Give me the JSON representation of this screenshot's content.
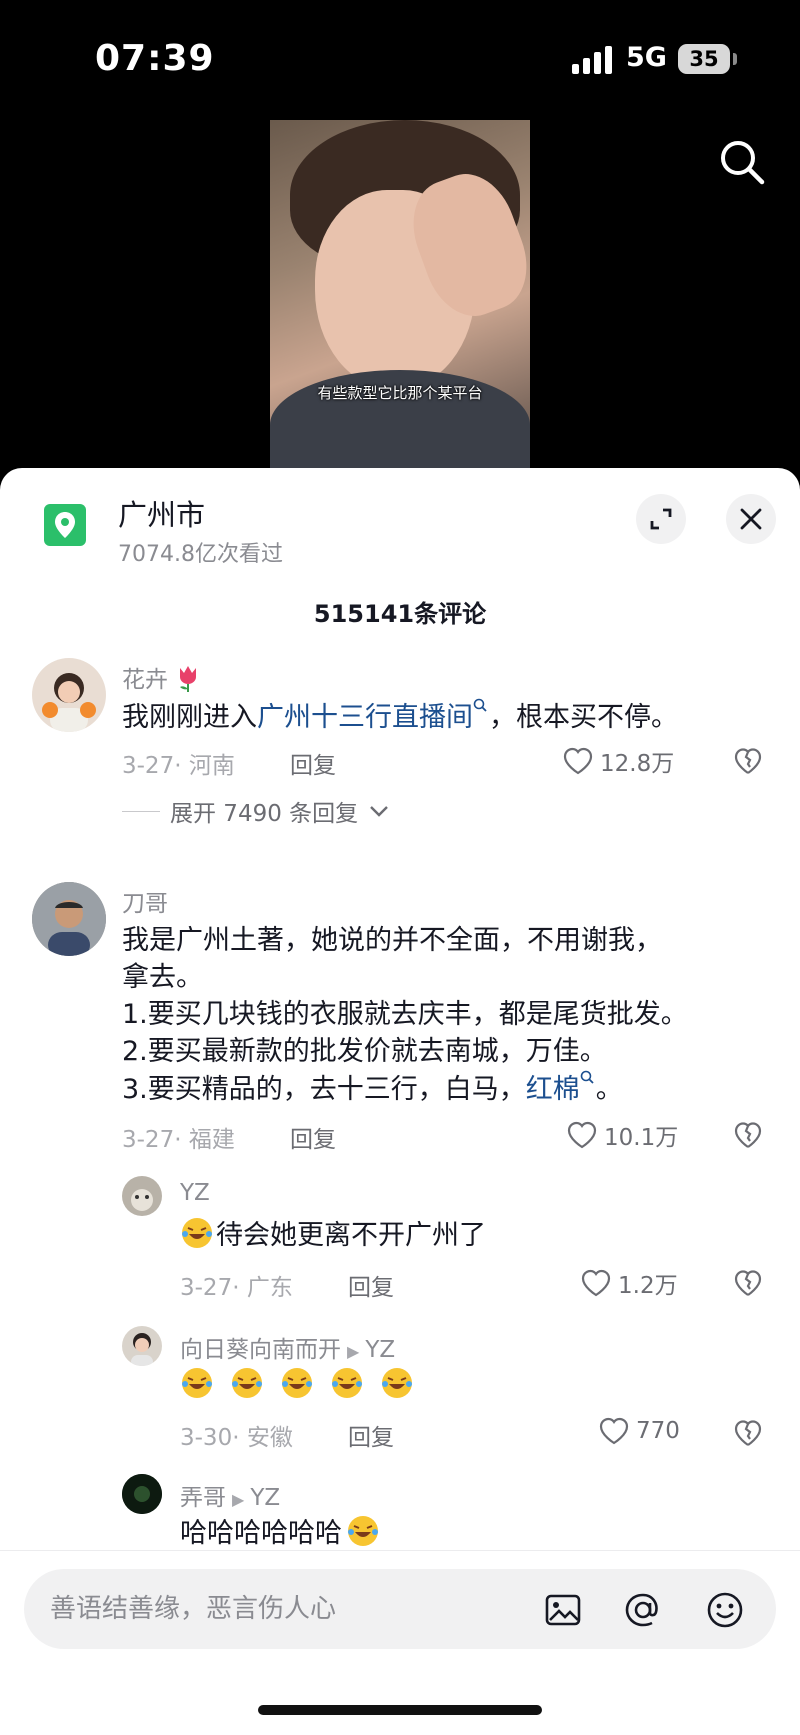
{
  "status_bar": {
    "time": "07:39",
    "network": "5G",
    "battery": "35"
  },
  "video": {
    "caption": "有些款型它比那个某平台"
  },
  "location": {
    "title": "广州市",
    "views": "7074.8亿次看过"
  },
  "comments_header": {
    "title": "515141条评论"
  },
  "comments": [
    {
      "user": "花卉",
      "text_before": "我刚刚进入",
      "link": "广州十三行直播间",
      "text_after": "，根本买不停。",
      "date_loc": "3-27· 河南",
      "reply_label": "回复",
      "likes": "12.8万",
      "expand_label": "展开 7490 条回复"
    },
    {
      "user": "刀哥",
      "line1": "我是广州土著，她说的并不全面，不用谢我，",
      "line2": "拿去。",
      "line3": "1.要买几块钱的衣服就去庆丰，都是尾货批发。",
      "line4": "2.要买最新款的批发价就去南城，万佳。",
      "line5_before": "3.要买精品的，去十三行，白马，",
      "line5_link": "红棉",
      "line5_after": "。",
      "date_loc": "3-27· 福建",
      "reply_label": "回复",
      "likes": "10.1万"
    }
  ],
  "replies": [
    {
      "user": "YZ",
      "text": "待会她更离不开广州了",
      "date_loc": "3-27· 广东",
      "reply_label": "回复",
      "likes": "1.2万"
    },
    {
      "user": "向日葵向南而开",
      "reply_to": "YZ",
      "date_loc": "3-30· 安徽",
      "reply_label": "回复",
      "likes": "770"
    },
    {
      "user": "弄哥",
      "reply_to": "YZ",
      "text": "哈哈哈哈哈哈"
    }
  ],
  "input": {
    "placeholder": "善语结善缘，恶言伤人心"
  },
  "colors": {
    "accent_link": "#1c4f8f",
    "location_icon": "#2bbf6a",
    "muted": "#8a8b91"
  }
}
